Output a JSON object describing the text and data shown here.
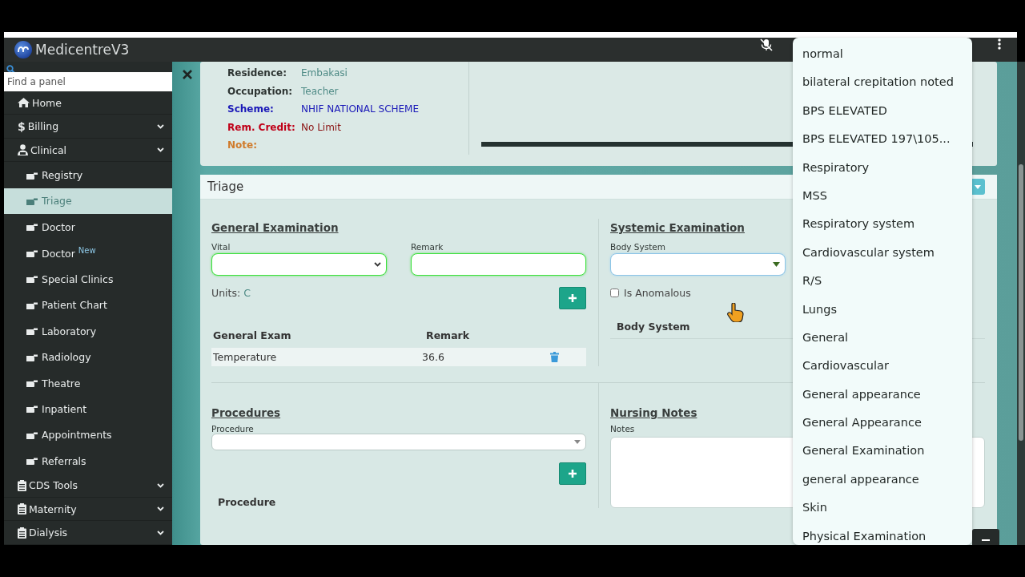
{
  "app": {
    "title": "MedicentreV3"
  },
  "sidebar": {
    "search": {
      "placeholder": "Find a panel"
    },
    "items": [
      {
        "label": "Home",
        "kind": "home",
        "selected": false
      },
      {
        "label": "Billing",
        "kind": "billing",
        "icon_text": "$",
        "selected": false
      },
      {
        "label": "Clinical",
        "kind": "clinical",
        "expanded": true,
        "selected": false,
        "children": [
          {
            "label": "Registry",
            "selected": false
          },
          {
            "label": "Triage",
            "selected": true
          },
          {
            "label": "Doctor",
            "selected": false
          },
          {
            "label": "Doctor $^{New}$",
            "selected": false
          },
          {
            "label": "Special Clinics",
            "selected": false
          },
          {
            "label": "Patient Chart",
            "selected": false
          },
          {
            "label": "Laboratory",
            "selected": false
          },
          {
            "label": "Radiology",
            "selected": false
          },
          {
            "label": "Theatre",
            "selected": false
          },
          {
            "label": "Inpatient",
            "selected": false
          },
          {
            "label": "Appointments",
            "selected": false
          },
          {
            "label": "Referrals",
            "selected": false
          }
        ]
      },
      {
        "label": "CDS Tools",
        "kind": "module",
        "selected": false
      },
      {
        "label": "Maternity",
        "kind": "module",
        "selected": false
      },
      {
        "label": "Dialysis",
        "kind": "module",
        "selected": false
      }
    ]
  },
  "patient": {
    "rows": [
      {
        "label": "Residence:",
        "value": "Embakasi",
        "kind": "plain"
      },
      {
        "label": "Occupation:",
        "value": "Teacher",
        "kind": "plain"
      },
      {
        "label": "Scheme:",
        "value": "NHIF NATIONAL SCHEME",
        "kind": "scheme"
      },
      {
        "label": "Rem. Credit:",
        "value": "No Limit",
        "kind": "credit"
      },
      {
        "label": "Note:",
        "kind": "note"
      }
    ]
  },
  "triage": {
    "title": "Triage",
    "general_exam": {
      "title": "General Examination",
      "vital_label": "Vital",
      "remark_label": "Remark",
      "units_label": "Units:",
      "units_value": "C",
      "table": {
        "columns": [
          "General Exam",
          "Remark"
        ],
        "rows": [
          {
            "cells": [
              "Temperature",
              "36.6"
            ]
          }
        ]
      }
    },
    "systemic_exam": {
      "title": "Systemic Examination",
      "body_system_label": "Body System",
      "anomalous": {
        "label": "Is Anomalous",
        "checked": false
      },
      "table": {
        "columns": [
          "Body System"
        ]
      }
    },
    "procedures": {
      "title": "Procedures",
      "procedure_label": "Procedure",
      "table": {
        "columns": [
          "Procedure"
        ]
      }
    },
    "nursing_notes": {
      "title": "Nursing Notes",
      "notes_label": "Notes"
    }
  },
  "dropdown": {
    "options": [
      {
        "label": "normal",
        "selected": false
      },
      {
        "label": "bilateral crepitation noted",
        "selected": false
      },
      {
        "label": "BPS ELEVATED",
        "selected": false
      },
      {
        "label": "BPS ELEVATED  197\\105...",
        "selected": false
      },
      {
        "label": "Respiratory",
        "selected": false
      },
      {
        "label": "MSS",
        "selected": false
      },
      {
        "label": "Respiratory system",
        "selected": false
      },
      {
        "label": "Cardiovascular system",
        "selected": false
      },
      {
        "label": "R/S",
        "selected": false
      },
      {
        "label": "Lungs",
        "selected": false
      },
      {
        "label": "General",
        "selected": false
      },
      {
        "label": "Cardiovascular",
        "selected": false
      },
      {
        "label": "General appearance",
        "selected": false
      },
      {
        "label": "General Appearance",
        "selected": false
      },
      {
        "label": "General Examination",
        "selected": false
      },
      {
        "label": "general appearance",
        "selected": false
      },
      {
        "label": "Skin",
        "selected": false
      },
      {
        "label": "Physical Examination",
        "selected": false
      }
    ]
  }
}
